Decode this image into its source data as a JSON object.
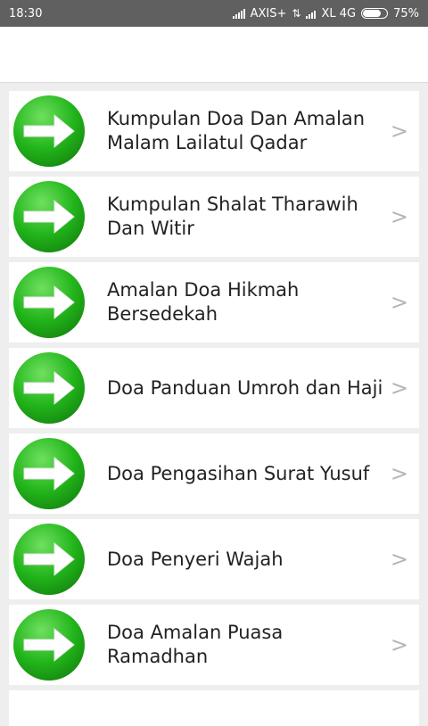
{
  "status": {
    "time": "18:30",
    "carrier1": "AXIS+",
    "carrier2": "XL 4G",
    "battery": "75%",
    "battery_level": 0.75
  },
  "colors": {
    "icon_green": "#22b51b",
    "chevron": "#b5b5b5"
  },
  "list": {
    "items": [
      {
        "label": "Kumpulan Doa Dan Amalan Malam Lailatul Qadar",
        "icon": "arrow-right-icon",
        "chevron": ">"
      },
      {
        "label": "Kumpulan Shalat Tharawih Dan Witir",
        "icon": "arrow-right-icon",
        "chevron": ">"
      },
      {
        "label": "Amalan Doa Hikmah Bersedekah",
        "icon": "arrow-right-icon",
        "chevron": ">"
      },
      {
        "label": "Doa Panduan Umroh dan Haji",
        "icon": "arrow-right-icon",
        "chevron": ">"
      },
      {
        "label": "Doa Pengasihan Surat Yusuf",
        "icon": "arrow-right-icon",
        "chevron": ">"
      },
      {
        "label": "Doa Penyeri Wajah",
        "icon": "arrow-right-icon",
        "chevron": ">"
      },
      {
        "label": "Doa Amalan Puasa Ramadhan",
        "icon": "arrow-right-icon",
        "chevron": ">"
      }
    ]
  }
}
